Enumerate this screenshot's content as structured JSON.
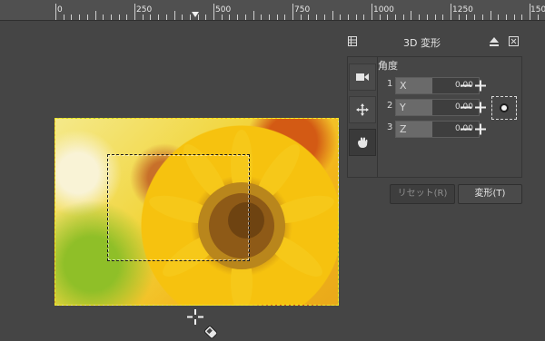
{
  "ruler": {
    "labels": [
      "0",
      "250",
      "500",
      "750",
      "1000",
      "1250",
      "1500"
    ]
  },
  "panel": {
    "title": "3D 変形",
    "section_label": "角度",
    "axes": [
      {
        "index": "1",
        "letter": "X",
        "value": "0.00"
      },
      {
        "index": "2",
        "letter": "Y",
        "value": "0.00"
      },
      {
        "index": "3",
        "letter": "Z",
        "value": "0.00"
      }
    ],
    "modes": [
      "camera-icon",
      "move-icon",
      "hand-icon"
    ],
    "active_mode": "hand-icon"
  },
  "buttons": {
    "reset_label": "リセット(R)",
    "transform_label": "変形(T)"
  },
  "colors": {
    "background": "#454545",
    "selection_outline": "#f2ea2a",
    "panel_border": "#353535"
  }
}
